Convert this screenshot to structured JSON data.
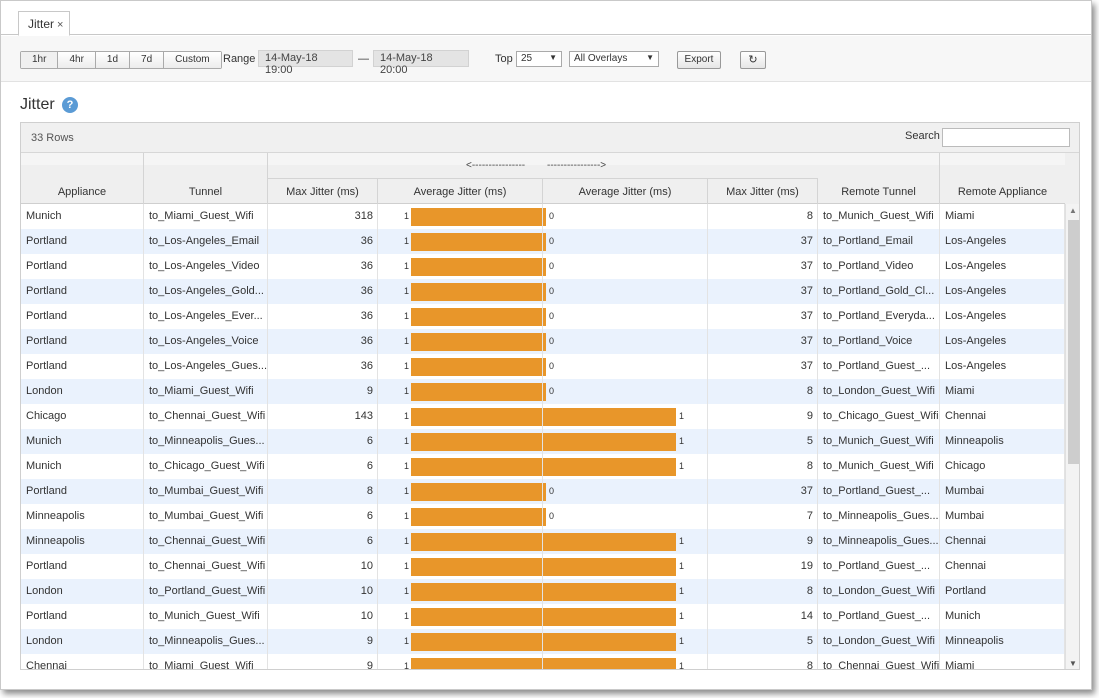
{
  "tab": {
    "label": "Jitter",
    "close": "×"
  },
  "toolbar": {
    "range_buttons": [
      "1hr",
      "4hr",
      "1d",
      "7d",
      "Custom"
    ],
    "range_label": "Range",
    "range_start": "14-May-18 19:00",
    "range_sep": "—",
    "range_end": "14-May-18 20:00",
    "top_label": "Top",
    "top_value": "25",
    "overlay_value": "All Overlays",
    "export_label": "Export",
    "refresh_icon": "↻"
  },
  "page": {
    "title": "Jitter",
    "help_icon": "?"
  },
  "table": {
    "rows_count": "33 Rows",
    "search_label": "Search",
    "search_value": "",
    "arrow_left": "<----------------",
    "arrow_right": "---------------->",
    "headers": [
      "Appliance",
      "Tunnel",
      "Max Jitter (ms)",
      "Average Jitter (ms)",
      "Average Jitter (ms)",
      "Max Jitter (ms)",
      "Remote Tunnel",
      "Remote Appliance"
    ],
    "bar_color": "#e8962a",
    "rows": [
      {
        "appliance": "Munich",
        "tunnel": "to_Miami_Guest_Wifi",
        "max_l": "318",
        "avg_l": "1",
        "avg_r": "0",
        "max_r": "8",
        "rtunnel": "to_Munich_Guest_Wifi",
        "rappliance": "Miami"
      },
      {
        "appliance": "Portland",
        "tunnel": "to_Los-Angeles_Email",
        "max_l": "36",
        "avg_l": "1",
        "avg_r": "0",
        "max_r": "37",
        "rtunnel": "to_Portland_Email",
        "rappliance": "Los-Angeles"
      },
      {
        "appliance": "Portland",
        "tunnel": "to_Los-Angeles_Video",
        "max_l": "36",
        "avg_l": "1",
        "avg_r": "0",
        "max_r": "37",
        "rtunnel": "to_Portland_Video",
        "rappliance": "Los-Angeles"
      },
      {
        "appliance": "Portland",
        "tunnel": "to_Los-Angeles_Gold...",
        "max_l": "36",
        "avg_l": "1",
        "avg_r": "0",
        "max_r": "37",
        "rtunnel": "to_Portland_Gold_Cl...",
        "rappliance": "Los-Angeles"
      },
      {
        "appliance": "Portland",
        "tunnel": "to_Los-Angeles_Ever...",
        "max_l": "36",
        "avg_l": "1",
        "avg_r": "0",
        "max_r": "37",
        "rtunnel": "to_Portland_Everyda...",
        "rappliance": "Los-Angeles"
      },
      {
        "appliance": "Portland",
        "tunnel": "to_Los-Angeles_Voice",
        "max_l": "36",
        "avg_l": "1",
        "avg_r": "0",
        "max_r": "37",
        "rtunnel": "to_Portland_Voice",
        "rappliance": "Los-Angeles"
      },
      {
        "appliance": "Portland",
        "tunnel": "to_Los-Angeles_Gues...",
        "max_l": "36",
        "avg_l": "1",
        "avg_r": "0",
        "max_r": "37",
        "rtunnel": "to_Portland_Guest_...",
        "rappliance": "Los-Angeles"
      },
      {
        "appliance": "London",
        "tunnel": "to_Miami_Guest_Wifi",
        "max_l": "9",
        "avg_l": "1",
        "avg_r": "0",
        "max_r": "8",
        "rtunnel": "to_London_Guest_Wifi",
        "rappliance": "Miami"
      },
      {
        "appliance": "Chicago",
        "tunnel": "to_Chennai_Guest_Wifi",
        "max_l": "143",
        "avg_l": "1",
        "avg_r": "1",
        "max_r": "9",
        "rtunnel": "to_Chicago_Guest_Wifi",
        "rappliance": "Chennai"
      },
      {
        "appliance": "Munich",
        "tunnel": "to_Minneapolis_Gues...",
        "max_l": "6",
        "avg_l": "1",
        "avg_r": "1",
        "max_r": "5",
        "rtunnel": "to_Munich_Guest_Wifi",
        "rappliance": "Minneapolis"
      },
      {
        "appliance": "Munich",
        "tunnel": "to_Chicago_Guest_Wifi",
        "max_l": "6",
        "avg_l": "1",
        "avg_r": "1",
        "max_r": "8",
        "rtunnel": "to_Munich_Guest_Wifi",
        "rappliance": "Chicago"
      },
      {
        "appliance": "Portland",
        "tunnel": "to_Mumbai_Guest_Wifi",
        "max_l": "8",
        "avg_l": "1",
        "avg_r": "0",
        "max_r": "37",
        "rtunnel": "to_Portland_Guest_...",
        "rappliance": "Mumbai"
      },
      {
        "appliance": "Minneapolis",
        "tunnel": "to_Mumbai_Guest_Wifi",
        "max_l": "6",
        "avg_l": "1",
        "avg_r": "0",
        "max_r": "7",
        "rtunnel": "to_Minneapolis_Gues...",
        "rappliance": "Mumbai"
      },
      {
        "appliance": "Minneapolis",
        "tunnel": "to_Chennai_Guest_Wifi",
        "max_l": "6",
        "avg_l": "1",
        "avg_r": "1",
        "max_r": "9",
        "rtunnel": "to_Minneapolis_Gues...",
        "rappliance": "Chennai"
      },
      {
        "appliance": "Portland",
        "tunnel": "to_Chennai_Guest_Wifi",
        "max_l": "10",
        "avg_l": "1",
        "avg_r": "1",
        "max_r": "19",
        "rtunnel": "to_Portland_Guest_...",
        "rappliance": "Chennai"
      },
      {
        "appliance": "London",
        "tunnel": "to_Portland_Guest_Wifi",
        "max_l": "10",
        "avg_l": "1",
        "avg_r": "1",
        "max_r": "8",
        "rtunnel": "to_London_Guest_Wifi",
        "rappliance": "Portland"
      },
      {
        "appliance": "Portland",
        "tunnel": "to_Munich_Guest_Wifi",
        "max_l": "10",
        "avg_l": "1",
        "avg_r": "1",
        "max_r": "14",
        "rtunnel": "to_Portland_Guest_...",
        "rappliance": "Munich"
      },
      {
        "appliance": "London",
        "tunnel": "to_Minneapolis_Gues...",
        "max_l": "9",
        "avg_l": "1",
        "avg_r": "1",
        "max_r": "5",
        "rtunnel": "to_London_Guest_Wifi",
        "rappliance": "Minneapolis"
      },
      {
        "appliance": "Chennai",
        "tunnel": "to_Miami_Guest_Wifi",
        "max_l": "9",
        "avg_l": "1",
        "avg_r": "1",
        "max_r": "8",
        "rtunnel": "to_Chennai_Guest_Wifi",
        "rappliance": "Miami"
      }
    ]
  }
}
